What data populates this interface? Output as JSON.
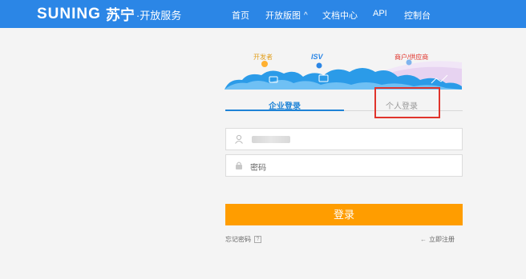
{
  "header": {
    "brand_word": "SUNING",
    "brand_cn": "苏宁",
    "brand_sub": "·开放服务",
    "nav": [
      {
        "label": "首页"
      },
      {
        "label": "开放版图"
      },
      {
        "label": "文档中心"
      },
      {
        "label": "API"
      },
      {
        "label": "控制台"
      }
    ]
  },
  "banner": {
    "developer": "开发者",
    "isv": "ISV",
    "merchant": "商户/供应商"
  },
  "tabs": {
    "enterprise": "企业登录",
    "personal": "个人登录"
  },
  "form": {
    "username_icon": "user-icon",
    "password_icon": "lock-icon",
    "password_placeholder": "密码"
  },
  "login_button": "登录",
  "forgot_password": "忘记密码",
  "forgot_icon": "?",
  "register": "立即注册",
  "colors": {
    "topbar": "#2b86e6",
    "accent_blue": "#1e83d6",
    "login_orange": "#ff9d00",
    "highlight_red": "#e0342c"
  }
}
